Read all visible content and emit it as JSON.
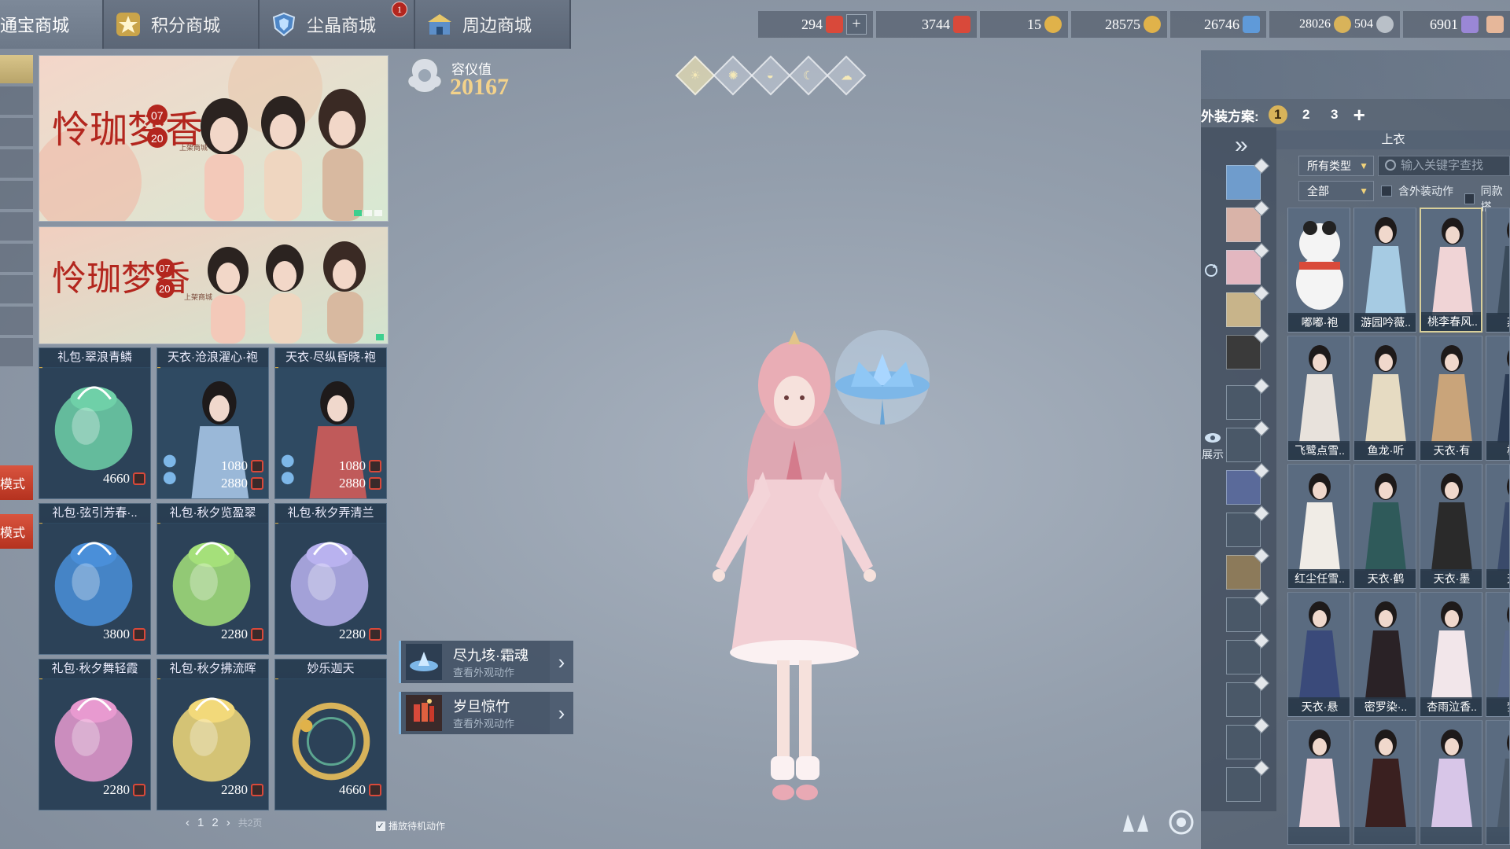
{
  "tabs": [
    {
      "label": "通宝商城",
      "active": true
    },
    {
      "label": "积分商城",
      "active": false
    },
    {
      "label": "尘晶商城",
      "active": false,
      "badge": "1"
    },
    {
      "label": "周边商城",
      "active": false
    }
  ],
  "currencies": [
    {
      "value": "294",
      "icon": "red-ticket-icon",
      "color": "#d9493a"
    },
    {
      "value": "3744",
      "icon": "red-coin-icon",
      "color": "#d9493a"
    },
    {
      "value": "15",
      "icon": "gold-medal-icon",
      "color": "#e0b24a"
    },
    {
      "value": "28575",
      "icon": "gold-star-icon",
      "color": "#e0b24a"
    },
    {
      "value": "26746",
      "icon": "blue-shield-icon",
      "color": "#5f9ad9"
    },
    {
      "value": "28026",
      "icon": "gold-coin-icon",
      "color": "#d8b35a"
    },
    {
      "value": "504",
      "icon": "silver-coin-icon",
      "color": "#b9c0c8"
    },
    {
      "value": "6901",
      "icon": "purple-gem-icon",
      "color": "#9a87d6"
    }
  ],
  "side": {
    "mode1": "模式",
    "mode2": "模式"
  },
  "banners": [
    {
      "title": "怜珈梦香",
      "date_top": "07",
      "date_bottom": "20",
      "note": "上架商城"
    },
    {
      "title": "怜珈梦香",
      "date_top": "07",
      "date_bottom": "20",
      "note": "上架商城"
    }
  ],
  "items": [
    {
      "title": "礼包·翠浪青鳞",
      "prices": [
        "4660"
      ],
      "art": "bag",
      "tone": "#6fd0a8"
    },
    {
      "title": "天衣·沧浪濯心·袍",
      "prices": [
        "1080",
        "2880"
      ],
      "art": "char",
      "tone": "#9ab8d8"
    },
    {
      "title": "天衣·尽纵昏晓·袍",
      "prices": [
        "1080",
        "2880"
      ],
      "art": "char",
      "tone": "#c05a5a"
    },
    {
      "title": "礼包·弦引芳春·..",
      "prices": [
        "3800"
      ],
      "art": "bag",
      "tone": "#4a8fd9"
    },
    {
      "title": "礼包·秋夕览盈翠",
      "prices": [
        "2280"
      ],
      "art": "bag",
      "tone": "#a5e07a"
    },
    {
      "title": "礼包·秋夕弄清兰",
      "prices": [
        "2280"
      ],
      "art": "bag",
      "tone": "#b9b2ef"
    },
    {
      "title": "礼包·秋夕舞轻霞",
      "prices": [
        "2280"
      ],
      "art": "bag",
      "tone": "#e89ad0"
    },
    {
      "title": "礼包·秋夕拂流晖",
      "prices": [
        "2280"
      ],
      "art": "bag",
      "tone": "#f2d97a"
    },
    {
      "title": "妙乐迦天",
      "prices": [
        "4660"
      ],
      "art": "ring",
      "tone": "#d8b35a"
    }
  ],
  "pager": {
    "prev": "‹",
    "page1": "1",
    "page2": "2",
    "next": "›",
    "total": "共2页"
  },
  "rongyi": {
    "label": "容仪值",
    "value": "20167"
  },
  "weather": [
    "☀",
    "✺",
    "◒",
    "☾",
    "☁"
  ],
  "actions": [
    {
      "name": "尽九垓·霜魂",
      "sub": "查看外观动作"
    },
    {
      "name": "岁旦惊竹",
      "sub": "查看外观动作"
    }
  ],
  "idle_label": "播放待机动作",
  "right": {
    "scheme_label": "外装方案:",
    "schemes": [
      "1",
      "2",
      "3"
    ],
    "add": "+",
    "category_title": "上衣",
    "filter_type": "所有类型",
    "filter_all": "全部",
    "search_placeholder": "输入关键字查找",
    "cb1": "含外装动作",
    "cb2": "同款搭",
    "show_label": "展示",
    "expand": "»"
  },
  "outfits": [
    "嘟嘟·袍",
    "游园吟薇..",
    "桃李春风..",
    "燕朋",
    "飞鹭点雪..",
    "鱼龙·听",
    "天衣·有",
    "横渡",
    "红尘任雪..",
    "天衣·鹤",
    "天衣·墨",
    "天衣",
    "天衣·悬",
    "密罗染·..",
    "杏雨泣香..",
    "梦烟",
    "",
    "",
    "",
    ""
  ]
}
